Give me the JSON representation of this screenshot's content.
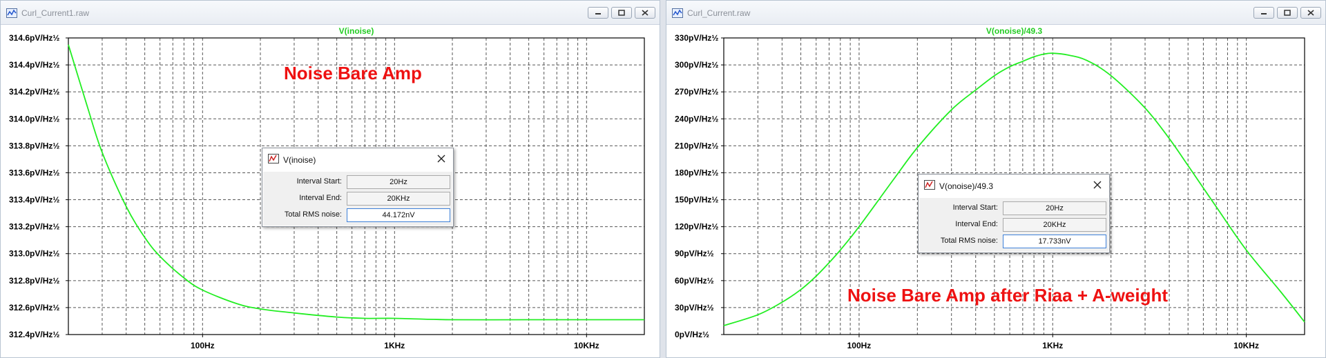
{
  "windows": [
    {
      "title": "Curl_Current1.raw",
      "trace_title": "V(inoise)",
      "annotation": "Noise Bare Amp",
      "dialog": {
        "title": "V(inoise)",
        "interval_start_label": "Interval Start:",
        "interval_start_value": "20Hz",
        "interval_end_label": "Interval End:",
        "interval_end_value": "20KHz",
        "rms_label": "Total RMS noise:",
        "rms_value": "44.172nV"
      }
    },
    {
      "title": "Curl_Current.raw",
      "trace_title": "V(onoise)/49.3",
      "annotation": "Noise Bare Amp after Riaa + A-weight",
      "dialog": {
        "title": "V(onoise)/49.3",
        "interval_start_label": "Interval Start:",
        "interval_start_value": "20Hz",
        "interval_end_label": "Interval End:",
        "interval_end_value": "20KHz",
        "rms_label": "Total RMS noise:",
        "rms_value": "17.733nV"
      }
    }
  ],
  "colors": {
    "trace": "#22ee22",
    "annotation": "#ee1111",
    "grid": "#555555"
  },
  "icons": [
    "ltspice-plot-icon",
    "minimize-icon",
    "maximize-icon",
    "close-icon"
  ],
  "chart_data": [
    {
      "type": "line",
      "title": "V(inoise)",
      "x_scale": "log",
      "xlim": [
        20,
        20000
      ],
      "ylim": [
        312.4,
        314.6
      ],
      "y_unit": "pV/Hz½",
      "x_ticks": [
        "100Hz",
        "1KHz",
        "10KHz"
      ],
      "y_ticks": [
        "314.6pV/Hz½",
        "314.4pV/Hz½",
        "314.2pV/Hz½",
        "314.0pV/Hz½",
        "313.8pV/Hz½",
        "313.6pV/Hz½",
        "313.4pV/Hz½",
        "313.2pV/Hz½",
        "313.0pV/Hz½",
        "312.8pV/Hz½",
        "312.6pV/Hz½",
        "312.4pV/Hz½"
      ],
      "series": [
        {
          "x": [
            20,
            25,
            30,
            40,
            50,
            60,
            80,
            100,
            150,
            200,
            300,
            500,
            700,
            1000,
            2000,
            5000,
            10000,
            20000
          ],
          "y": [
            314.55,
            314.1,
            313.75,
            313.35,
            313.12,
            312.98,
            312.82,
            312.73,
            312.63,
            312.59,
            312.56,
            312.53,
            312.52,
            312.52,
            312.51,
            312.51,
            312.51,
            312.51
          ]
        }
      ]
    },
    {
      "type": "line",
      "title": "V(onoise)/49.3",
      "x_scale": "log",
      "xlim": [
        20,
        20000
      ],
      "ylim": [
        0,
        330
      ],
      "y_unit": "pV/Hz½",
      "x_ticks": [
        "100Hz",
        "1KHz",
        "10KHz"
      ],
      "y_ticks": [
        "330pV/Hz½",
        "300pV/Hz½",
        "270pV/Hz½",
        "240pV/Hz½",
        "210pV/Hz½",
        "180pV/Hz½",
        "150pV/Hz½",
        "120pV/Hz½",
        "90pV/Hz½",
        "60pV/Hz½",
        "30pV/Hz½",
        "0pV/Hz½"
      ],
      "series": [
        {
          "x": [
            20,
            30,
            40,
            50,
            60,
            70,
            80,
            100,
            150,
            200,
            300,
            400,
            500,
            600,
            700,
            800,
            900,
            1000,
            1200,
            1500,
            2000,
            3000,
            4000,
            5000,
            7000,
            10000,
            15000,
            20000
          ],
          "y": [
            10,
            22,
            36,
            50,
            65,
            80,
            94,
            120,
            172,
            208,
            250,
            272,
            288,
            298,
            304,
            309,
            312,
            313,
            311,
            305,
            288,
            252,
            218,
            188,
            142,
            94,
            48,
            14
          ]
        }
      ]
    }
  ]
}
